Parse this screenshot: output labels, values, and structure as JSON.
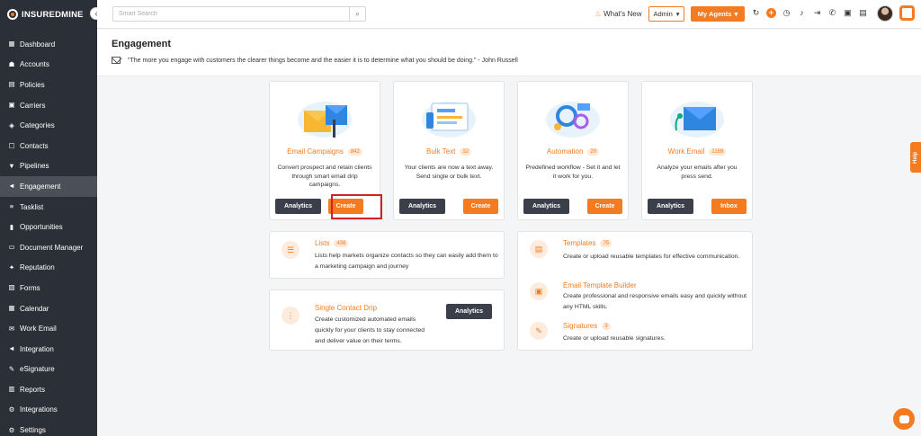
{
  "brand": {
    "name": "INSUREDMINE",
    "accent": "#f47b20",
    "sidebar_bg": "#2b2f38"
  },
  "sidebar": {
    "items": [
      {
        "label": "Dashboard",
        "icon": "grid-icon"
      },
      {
        "label": "Accounts",
        "icon": "users-icon"
      },
      {
        "label": "Policies",
        "icon": "file-icon"
      },
      {
        "label": "Carriers",
        "icon": "briefcase-icon"
      },
      {
        "label": "Categories",
        "icon": "tag-icon"
      },
      {
        "label": "Contacts",
        "icon": "contact-icon"
      },
      {
        "label": "Pipelines",
        "icon": "funnel-icon"
      },
      {
        "label": "Engagement",
        "icon": "megaphone-icon",
        "active": true
      },
      {
        "label": "Tasklist",
        "icon": "list-icon"
      },
      {
        "label": "Opportunities",
        "icon": "chart-icon"
      },
      {
        "label": "Document Manager",
        "icon": "folder-icon"
      },
      {
        "label": "Reputation",
        "icon": "star-icon"
      },
      {
        "label": "Forms",
        "icon": "form-icon"
      },
      {
        "label": "Calendar",
        "icon": "calendar-icon"
      },
      {
        "label": "Work Email",
        "icon": "mail-icon"
      },
      {
        "label": "Integration",
        "icon": "plug-icon"
      },
      {
        "label": "eSignature",
        "icon": "pen-icon"
      },
      {
        "label": "Reports",
        "icon": "report-icon"
      },
      {
        "label": "Integrations",
        "icon": "gears-icon"
      },
      {
        "label": "Settings",
        "icon": "gear-icon"
      }
    ]
  },
  "topbar": {
    "search_placeholder": "Smart Search",
    "whats_new": "What's New",
    "admin_select": "Admin",
    "agents_button": "My Agents"
  },
  "header": {
    "title": "Engagement",
    "quote": "\"The more you engage with customers the clearer things become and the easier it is to determine what you should be doing.\" - John Russell"
  },
  "features": [
    {
      "title": "Email Campaigns",
      "badge": "842",
      "desc": "Convert prospect and retain clients through smart email drip campaigns.",
      "btn1": "Analytics",
      "btn2": "Create"
    },
    {
      "title": "Bulk Text",
      "badge": "32",
      "desc": "Your clients are now a text away. Send single or bulk text.",
      "btn1": "Analytics",
      "btn2": "Create"
    },
    {
      "title": "Automation",
      "badge": "20",
      "desc": "Predefined workflow - Set it and let it work for you.",
      "btn1": "Analytics",
      "btn2": "Create"
    },
    {
      "title": "Work Email",
      "badge": "1169",
      "desc": "Analyze your emails after you press send.",
      "btn1": "Analytics",
      "btn2": "Inbox"
    }
  ],
  "lists": {
    "title": "Lists",
    "badge": "436",
    "desc": "Lists help markets organize contacts so they can easily add them to a marketing campaign and journey"
  },
  "drip": {
    "title": "Single Contact Drip",
    "desc": "Create customized automated emails quickly for your clients to stay connected and deliver value on their terms.",
    "btn": "Analytics"
  },
  "templates": {
    "title": "Templates",
    "badge": "75",
    "desc": "Create or upload reusable templates for effective communication."
  },
  "builder": {
    "title": "Email Template Builder",
    "desc": "Create professional and responsive emails easy and quickly without any HTML skills."
  },
  "signatures": {
    "title": "Signatures",
    "badge": "3",
    "desc": "Create or upload reusable signatures."
  },
  "help_tab": "Help"
}
